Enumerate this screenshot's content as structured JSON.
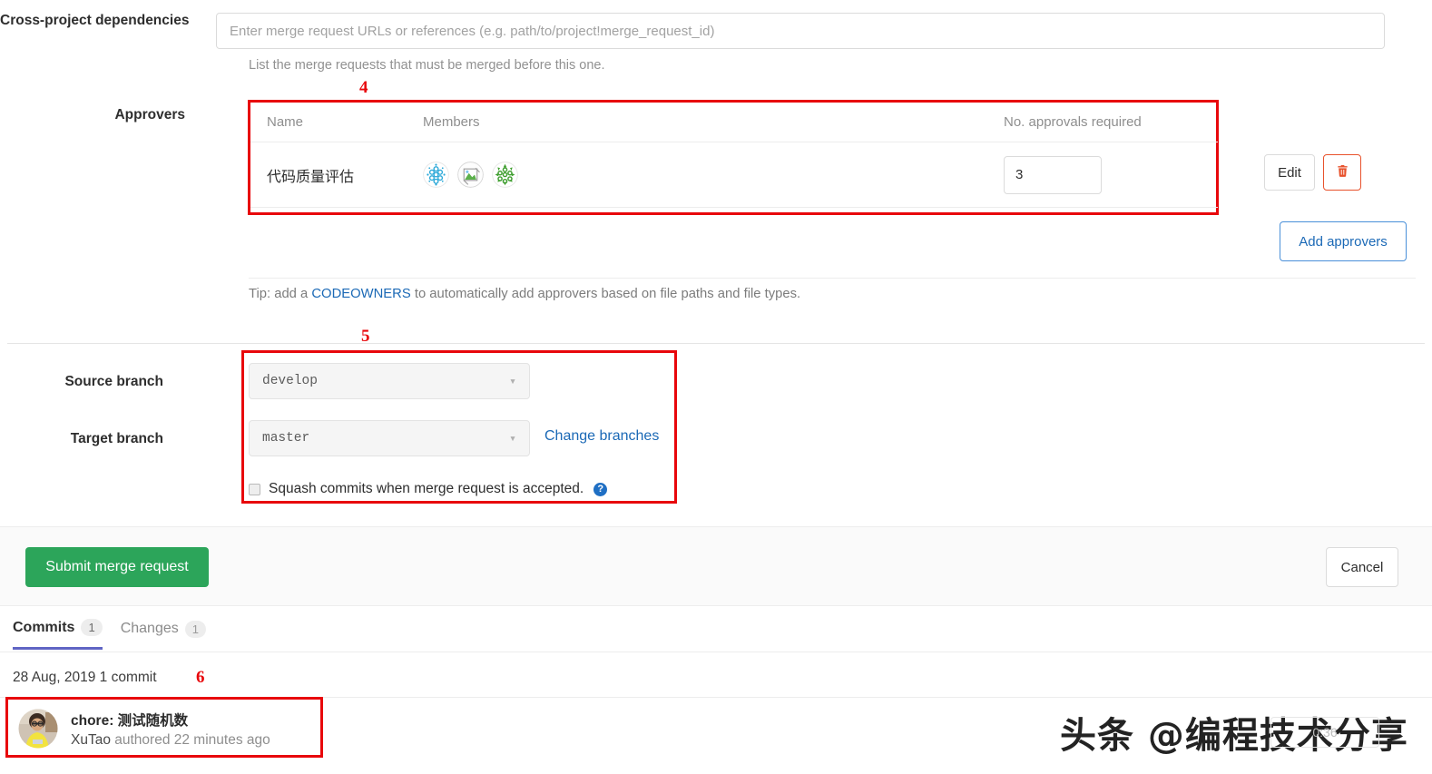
{
  "cross_project": {
    "label": "Cross-project dependencies",
    "input_value": "",
    "placeholder": "Enter merge request URLs or references (e.g. path/to/project!merge_request_id)",
    "helper": "List the merge requests that must be merged before this one."
  },
  "approvers": {
    "label": "Approvers",
    "annotation_number": "4",
    "columns": [
      "Name",
      "Members",
      "No. approvals required"
    ],
    "rows": [
      {
        "name": "代码质量评估",
        "members": [
          "blue-identicon-avatar",
          "broken-image-avatar",
          "green-identicon-avatar"
        ],
        "approvals_required": "3",
        "edit_label": "Edit",
        "delete_icon": "trash-icon"
      }
    ],
    "add_button": "Add approvers",
    "tip_prefix": "Tip: add a ",
    "tip_link": "CODEOWNERS",
    "tip_suffix": " to automatically add approvers based on file paths and file types."
  },
  "branches": {
    "annotation_number": "5",
    "source_label": "Source branch",
    "source_value": "develop",
    "target_label": "Target branch",
    "target_value": "master",
    "change_link": "Change branches",
    "squash_label": "Squash commits when merge request is accepted.",
    "squash_checked": false,
    "help_icon": "?"
  },
  "actions": {
    "submit_label": "Submit merge request",
    "cancel_label": "Cancel",
    "submit_color": "#2ca55a"
  },
  "tabs": [
    {
      "label": "Commits",
      "count": "1",
      "active": true
    },
    {
      "label": "Changes",
      "count": "1",
      "active": false
    }
  ],
  "commits": {
    "annotation_number": "6",
    "date_line": "28 Aug, 2019 1 commit",
    "items": [
      {
        "title": "chore: 测试随机数",
        "author": "XuTao",
        "meta_suffix": " authored 22 minutes ago",
        "avatar": "user-photo-avatar"
      }
    ]
  },
  "watermark": {
    "text": "头条 @编程技术分享",
    "badge": "0:36"
  }
}
